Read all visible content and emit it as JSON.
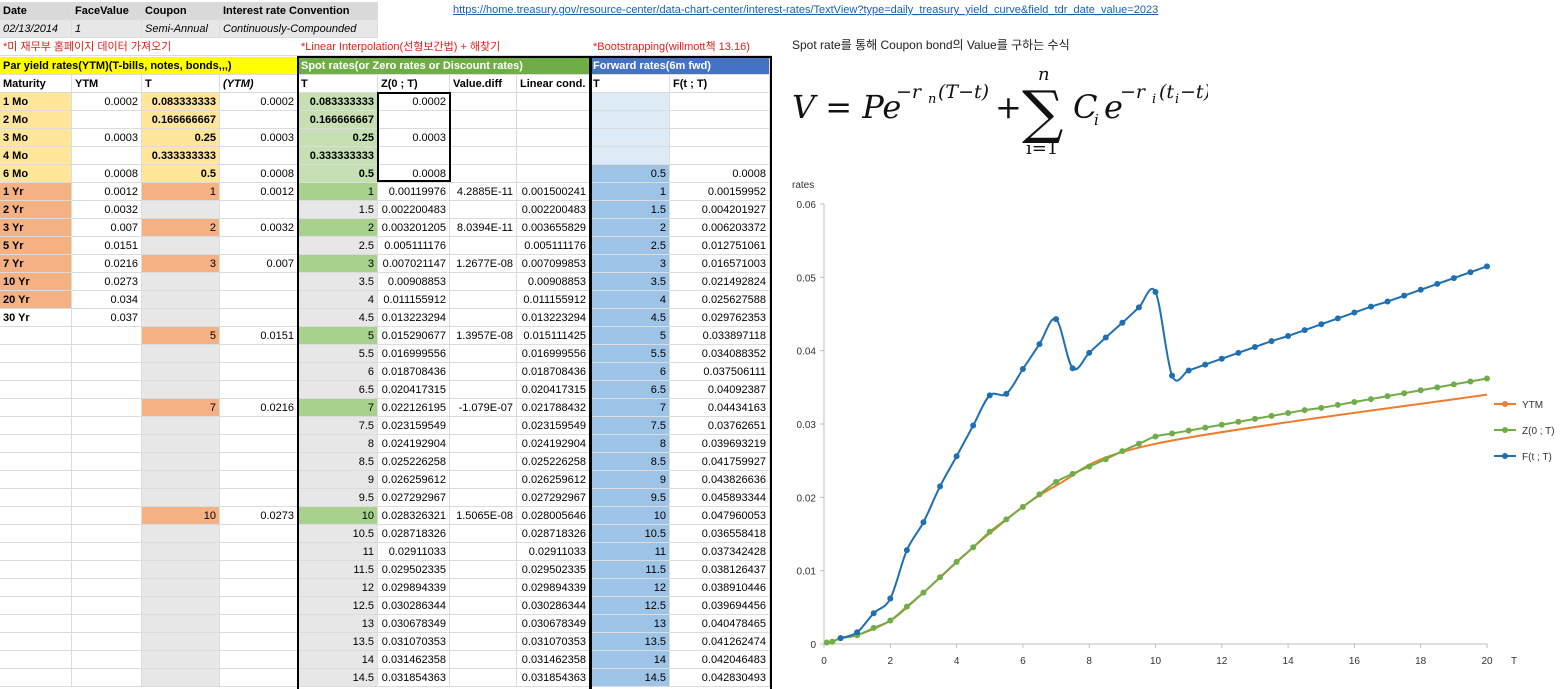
{
  "link_text": "https://home.treasury.gov/resource-center/data-chart-center/interest-rates/TextView?type=daily_treasury_yield_curve&field_tdr_date_value=2023",
  "info_headers": [
    "Date",
    "FaceValue",
    "Coupon",
    "Interest rate Convention"
  ],
  "info_values": [
    "02/13/2014",
    "1",
    "Semi-Annual",
    "Continuously-Compounded"
  ],
  "notes": {
    "treasury": "*미 재무부 홈페이지 데이터 가져오기",
    "interp": "*Linear Interpolation(선형보간법) + 해찾기",
    "boot": "*Bootstrapping(willmott책 13.16)"
  },
  "section_headers": {
    "par": "Par yield rates(YTM)(T-bills, notes, bonds,,,)",
    "spot": "Spot rates(or Zero rates or Discount rates)",
    "forward": "Forward rates(6m fwd)"
  },
  "col_headers": [
    "Maturity",
    "YTM",
    "T",
    "(YTM)",
    "T",
    "Z(0 ; T)",
    "Value.diff",
    "Linear cond.",
    "T",
    "F(t ; T)"
  ],
  "rows": [
    {
      "mat": "1 Mo",
      "ytm": "0.0002",
      "t1": "0.083333333",
      "y2": "0.0002",
      "t2": "0.083333333",
      "z": "0.0002",
      "vd": "",
      "lc": "",
      "t3": "",
      "f": ""
    },
    {
      "mat": "2 Mo",
      "ytm": "",
      "t1": "0.166666667",
      "y2": "",
      "t2": "0.166666667",
      "z": "",
      "vd": "",
      "lc": "",
      "t3": "",
      "f": ""
    },
    {
      "mat": "3 Mo",
      "ytm": "0.0003",
      "t1": "0.25",
      "y2": "0.0003",
      "t2": "0.25",
      "z": "0.0003",
      "vd": "",
      "lc": "",
      "t3": "",
      "f": ""
    },
    {
      "mat": "4 Mo",
      "ytm": "",
      "t1": "0.333333333",
      "y2": "",
      "t2": "0.333333333",
      "z": "",
      "vd": "",
      "lc": "",
      "t3": "",
      "f": ""
    },
    {
      "mat": "6 Mo",
      "ytm": "0.0008",
      "t1": "0.5",
      "y2": "0.0008",
      "t2": "0.5",
      "z": "0.0008",
      "vd": "",
      "lc": "",
      "t3": "0.5",
      "f": "0.0008"
    },
    {
      "mat": "1 Yr",
      "ytm": "0.0012",
      "t1": "1",
      "y2": "0.0012",
      "t2": "1",
      "z": "0.00119976",
      "vd": "4.2885E-11",
      "lc": "0.001500241",
      "t3": "1",
      "f": "0.00159952"
    },
    {
      "mat": "2 Yr",
      "ytm": "0.0032",
      "t1": "",
      "y2": "",
      "t2": "1.5",
      "z": "0.002200483",
      "vd": "",
      "lc": "0.002200483",
      "t3": "1.5",
      "f": "0.004201927"
    },
    {
      "mat": "3 Yr",
      "ytm": "0.007",
      "t1": "2",
      "y2": "0.0032",
      "t2": "2",
      "z": "0.003201205",
      "vd": "8.0394E-11",
      "lc": "0.003655829",
      "t3": "2",
      "f": "0.006203372"
    },
    {
      "mat": "5 Yr",
      "ytm": "0.0151",
      "t1": "",
      "y2": "",
      "t2": "2.5",
      "z": "0.005111176",
      "vd": "",
      "lc": "0.005111176",
      "t3": "2.5",
      "f": "0.012751061"
    },
    {
      "mat": "7 Yr",
      "ytm": "0.0216",
      "t1": "3",
      "y2": "0.007",
      "t2": "3",
      "z": "0.007021147",
      "vd": "1.2677E-08",
      "lc": "0.007099853",
      "t3": "3",
      "f": "0.016571003"
    },
    {
      "mat": "10 Yr",
      "ytm": "0.0273",
      "t1": "",
      "y2": "",
      "t2": "3.5",
      "z": "0.00908853",
      "vd": "",
      "lc": "0.00908853",
      "t3": "3.5",
      "f": "0.021492824"
    },
    {
      "mat": "20 Yr",
      "ytm": "0.034",
      "t1": "",
      "y2": "",
      "t2": "4",
      "z": "0.011155912",
      "vd": "",
      "lc": "0.011155912",
      "t3": "4",
      "f": "0.025627588"
    },
    {
      "mat": "30 Yr",
      "ytm": "0.037",
      "t1": "",
      "y2": "",
      "t2": "4.5",
      "z": "0.013223294",
      "vd": "",
      "lc": "0.013223294",
      "t3": "4.5",
      "f": "0.029762353"
    },
    {
      "mat": "",
      "ytm": "",
      "t1": "5",
      "y2": "0.0151",
      "t2": "5",
      "z": "0.015290677",
      "vd": "1.3957E-08",
      "lc": "0.015111425",
      "t3": "5",
      "f": "0.033897118"
    },
    {
      "mat": "",
      "ytm": "",
      "t1": "",
      "y2": "",
      "t2": "5.5",
      "z": "0.016999556",
      "vd": "",
      "lc": "0.016999556",
      "t3": "5.5",
      "f": "0.034088352"
    },
    {
      "mat": "",
      "ytm": "",
      "t1": "",
      "y2": "",
      "t2": "6",
      "z": "0.018708436",
      "vd": "",
      "lc": "0.018708436",
      "t3": "6",
      "f": "0.037506111"
    },
    {
      "mat": "",
      "ytm": "",
      "t1": "",
      "y2": "",
      "t2": "6.5",
      "z": "0.020417315",
      "vd": "",
      "lc": "0.020417315",
      "t3": "6.5",
      "f": "0.04092387"
    },
    {
      "mat": "",
      "ytm": "",
      "t1": "7",
      "y2": "0.0216",
      "t2": "7",
      "z": "0.022126195",
      "vd": "-1.079E-07",
      "lc": "0.021788432",
      "t3": "7",
      "f": "0.04434163"
    },
    {
      "mat": "",
      "ytm": "",
      "t1": "",
      "y2": "",
      "t2": "7.5",
      "z": "0.023159549",
      "vd": "",
      "lc": "0.023159549",
      "t3": "7.5",
      "f": "0.03762651"
    },
    {
      "mat": "",
      "ytm": "",
      "t1": "",
      "y2": "",
      "t2": "8",
      "z": "0.024192904",
      "vd": "",
      "lc": "0.024192904",
      "t3": "8",
      "f": "0.039693219"
    },
    {
      "mat": "",
      "ytm": "",
      "t1": "",
      "y2": "",
      "t2": "8.5",
      "z": "0.025226258",
      "vd": "",
      "lc": "0.025226258",
      "t3": "8.5",
      "f": "0.041759927"
    },
    {
      "mat": "",
      "ytm": "",
      "t1": "",
      "y2": "",
      "t2": "9",
      "z": "0.026259612",
      "vd": "",
      "lc": "0.026259612",
      "t3": "9",
      "f": "0.043826636"
    },
    {
      "mat": "",
      "ytm": "",
      "t1": "",
      "y2": "",
      "t2": "9.5",
      "z": "0.027292967",
      "vd": "",
      "lc": "0.027292967",
      "t3": "9.5",
      "f": "0.045893344"
    },
    {
      "mat": "",
      "ytm": "",
      "t1": "10",
      "y2": "0.0273",
      "t2": "10",
      "z": "0.028326321",
      "vd": "1.5065E-08",
      "lc": "0.028005646",
      "t3": "10",
      "f": "0.047960053"
    },
    {
      "mat": "",
      "ytm": "",
      "t1": "",
      "y2": "",
      "t2": "10.5",
      "z": "0.028718326",
      "vd": "",
      "lc": "0.028718326",
      "t3": "10.5",
      "f": "0.036558418"
    },
    {
      "mat": "",
      "ytm": "",
      "t1": "",
      "y2": "",
      "t2": "11",
      "z": "0.02911033",
      "vd": "",
      "lc": "0.02911033",
      "t3": "11",
      "f": "0.037342428"
    },
    {
      "mat": "",
      "ytm": "",
      "t1": "",
      "y2": "",
      "t2": "11.5",
      "z": "0.029502335",
      "vd": "",
      "lc": "0.029502335",
      "t3": "11.5",
      "f": "0.038126437"
    },
    {
      "mat": "",
      "ytm": "",
      "t1": "",
      "y2": "",
      "t2": "12",
      "z": "0.029894339",
      "vd": "",
      "lc": "0.029894339",
      "t3": "12",
      "f": "0.038910446"
    },
    {
      "mat": "",
      "ytm": "",
      "t1": "",
      "y2": "",
      "t2": "12.5",
      "z": "0.030286344",
      "vd": "",
      "lc": "0.030286344",
      "t3": "12.5",
      "f": "0.039694456"
    },
    {
      "mat": "",
      "ytm": "",
      "t1": "",
      "y2": "",
      "t2": "13",
      "z": "0.030678349",
      "vd": "",
      "lc": "0.030678349",
      "t3": "13",
      "f": "0.040478465"
    },
    {
      "mat": "",
      "ytm": "",
      "t1": "",
      "y2": "",
      "t2": "13.5",
      "z": "0.031070353",
      "vd": "",
      "lc": "0.031070353",
      "t3": "13.5",
      "f": "0.041262474"
    },
    {
      "mat": "",
      "ytm": "",
      "t1": "",
      "y2": "",
      "t2": "14",
      "z": "0.031462358",
      "vd": "",
      "lc": "0.031462358",
      "t3": "14",
      "f": "0.042046483"
    },
    {
      "mat": "",
      "ytm": "",
      "t1": "",
      "y2": "",
      "t2": "14.5",
      "z": "0.031854363",
      "vd": "",
      "lc": "0.031854363",
      "t3": "14.5",
      "f": "0.042830493"
    }
  ],
  "formula": {
    "title": "Spot rate를 통해 Coupon bond의 Value를 구하는 수식",
    "lhs": "V = Pe",
    "exp1": "−r",
    "exp1_sub": "n",
    "exp1_rest": "(T−t)",
    "plus": "+",
    "sum_sym": "∑",
    "sum_top": "n",
    "sum_bot": "i=1",
    "term": "C",
    "term_sub": "i",
    "term_e": "e",
    "exp2": "−r",
    "exp2_sub": "i",
    "exp2_rest": "(t",
    "exp2_sub2": "i",
    "exp2_end": "−t)"
  },
  "chart_data": {
    "type": "line",
    "ylabel": "rates",
    "xlabel": "T",
    "xlim": [
      0,
      20
    ],
    "ylim": [
      0,
      0.06
    ],
    "xticks": [
      "0",
      "2",
      "4",
      "6",
      "8",
      "10",
      "12",
      "14",
      "16",
      "18",
      "20"
    ],
    "yticks": [
      "0",
      "0.01",
      "0.02",
      "0.03",
      "0.04",
      "0.05",
      "0.06"
    ],
    "legend_position": "right",
    "series": [
      {
        "name": "YTM",
        "color": "#ed7d31",
        "markers": false,
        "x": [
          0.0833,
          0.25,
          0.5,
          1,
          2,
          3,
          5,
          7,
          10,
          20
        ],
        "y": [
          0.0002,
          0.0003,
          0.0008,
          0.0012,
          0.0032,
          0.007,
          0.0151,
          0.0216,
          0.0273,
          0.034
        ]
      },
      {
        "name": "Z(0 ; T)",
        "color": "#70ad47",
        "markers": true,
        "x": [
          0.0833,
          0.25,
          0.5,
          1,
          1.5,
          2,
          2.5,
          3,
          3.5,
          4,
          4.5,
          5,
          5.5,
          6,
          6.5,
          7,
          7.5,
          8,
          8.5,
          9,
          9.5,
          10,
          10.5,
          11,
          11.5,
          12,
          12.5,
          13,
          13.5,
          14,
          14.5,
          15,
          15.5,
          16,
          16.5,
          17,
          17.5,
          18,
          18.5,
          19,
          19.5,
          20
        ],
        "y": [
          0.0002,
          0.0003,
          0.0008,
          0.0012,
          0.0022,
          0.0032,
          0.0051,
          0.007,
          0.0091,
          0.0112,
          0.0132,
          0.0153,
          0.017,
          0.0187,
          0.0204,
          0.0221,
          0.0232,
          0.0242,
          0.0252,
          0.0263,
          0.0273,
          0.0283,
          0.0287,
          0.0291,
          0.0295,
          0.0299,
          0.0303,
          0.0307,
          0.0311,
          0.0315,
          0.0319,
          0.0322,
          0.0326,
          0.033,
          0.0334,
          0.0338,
          0.0342,
          0.0346,
          0.035,
          0.0354,
          0.0358,
          0.0362
        ]
      },
      {
        "name": "F(t ; T)",
        "color": "#1f6fb2",
        "markers": true,
        "x": [
          0.5,
          1,
          1.5,
          2,
          2.5,
          3,
          3.5,
          4,
          4.5,
          5,
          5.5,
          6,
          6.5,
          7,
          7.5,
          8,
          8.5,
          9,
          9.5,
          10,
          10.5,
          11,
          11.5,
          12,
          12.5,
          13,
          13.5,
          14,
          14.5,
          15,
          15.5,
          16,
          16.5,
          17,
          17.5,
          18,
          18.5,
          19,
          19.5,
          20
        ],
        "y": [
          0.0008,
          0.0016,
          0.0042,
          0.0062,
          0.0128,
          0.0166,
          0.0215,
          0.0256,
          0.0298,
          0.0339,
          0.0341,
          0.0375,
          0.0409,
          0.0443,
          0.0376,
          0.0397,
          0.0418,
          0.0438,
          0.0459,
          0.048,
          0.0366,
          0.0373,
          0.0381,
          0.0389,
          0.0397,
          0.0405,
          0.0413,
          0.042,
          0.0428,
          0.0436,
          0.0444,
          0.0452,
          0.046,
          0.0467,
          0.0475,
          0.0483,
          0.0491,
          0.0499,
          0.0507,
          0.0515
        ]
      }
    ]
  }
}
